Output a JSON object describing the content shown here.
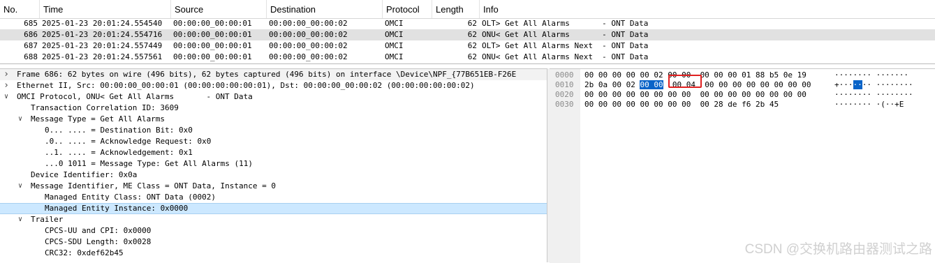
{
  "packet_list": {
    "columns": [
      "No.",
      "Time",
      "Source",
      "Destination",
      "Protocol",
      "Length",
      "Info"
    ],
    "rows": [
      {
        "no": "685",
        "time": "2025-01-23 20:01:24.554540",
        "src": "00:00:00_00:00:01",
        "dst": "00:00:00_00:00:02",
        "proto": "OMCI",
        "len": "62",
        "info": "OLT> Get All Alarms       - ONT Data"
      },
      {
        "no": "686",
        "time": "2025-01-23 20:01:24.554716",
        "src": "00:00:00_00:00:01",
        "dst": "00:00:00_00:00:02",
        "proto": "OMCI",
        "len": "62",
        "info": "ONU< Get All Alarms       - ONT Data"
      },
      {
        "no": "687",
        "time": "2025-01-23 20:01:24.557449",
        "src": "00:00:00_00:00:01",
        "dst": "00:00:00_00:00:02",
        "proto": "OMCI",
        "len": "62",
        "info": "OLT> Get All Alarms Next  - ONT Data"
      },
      {
        "no": "688",
        "time": "2025-01-23 20:01:24.557561",
        "src": "00:00:00_00:00:01",
        "dst": "00:00:00_00:00:02",
        "proto": "OMCI",
        "len": "62",
        "info": "ONU< Get All Alarms Next  - ONT Data"
      }
    ]
  },
  "details": {
    "lines": [
      {
        "arrow": "collapsed",
        "text": "Frame 686: 62 bytes on wire (496 bits), 62 bytes captured (496 bits) on interface \\Device\\NPF_{77B651EB-F26E"
      },
      {
        "arrow": "collapsed",
        "text": "Ethernet II, Src: 00:00:00_00:00:01 (00:00:00:00:00:01), Dst: 00:00:00_00:00:02 (00:00:00:00:00:02)"
      },
      {
        "arrow": "expanded",
        "text": "OMCI Protocol, ONU< Get All Alarms       - ONT Data"
      },
      {
        "arrow": "none",
        "text": "Transaction Correlation ID: 3609"
      },
      {
        "arrow": "expanded",
        "text": "Message Type = Get All Alarms"
      },
      {
        "arrow": "none",
        "text": "0... .... = Destination Bit: 0x0"
      },
      {
        "arrow": "none",
        "text": ".0.. .... = Acknowledge Request: 0x0"
      },
      {
        "arrow": "none",
        "text": "..1. .... = Acknowledgement: 0x1"
      },
      {
        "arrow": "none",
        "text": "...0 1011 = Message Type: Get All Alarms (11)"
      },
      {
        "arrow": "none",
        "text": "Device Identifier: 0x0a"
      },
      {
        "arrow": "expanded",
        "text": "Message Identifier, ME Class = ONT Data, Instance = 0"
      },
      {
        "arrow": "none",
        "text": "Managed Entity Class: ONT Data (0002)"
      },
      {
        "arrow": "none",
        "text": "Managed Entity Instance: 0x0000"
      },
      {
        "arrow": "expanded",
        "text": "Trailer"
      },
      {
        "arrow": "none",
        "text": "CPCS-UU and CPI: 0x0000"
      },
      {
        "arrow": "none",
        "text": "CPCS-SDU Length: 0x0028"
      },
      {
        "arrow": "none",
        "text": "CRC32: 0xdef62b45"
      }
    ]
  },
  "bytes": {
    "rows": [
      {
        "offset": "0000",
        "pre": "00 00 00 00 00 02 00 00  00 00 00 01 88 b5 0e 19",
        "hl": "",
        "post": "",
        "a_pre": "········ ·······",
        "a_hl": "",
        "a_post": ""
      },
      {
        "offset": "0010",
        "pre": "2b 0a 00 02 ",
        "hl": "00 00",
        "post": "  00 04  00 00 00 00 00 00 00 00",
        "a_pre": "+···",
        "a_hl": "··",
        "a_post": "·· ········"
      },
      {
        "offset": "0020",
        "pre": "00 00 00 00 00 00 00 00  00 00 00 00 00 00 00 00",
        "hl": "",
        "post": "",
        "a_pre": "········ ········",
        "a_hl": "",
        "a_post": ""
      },
      {
        "offset": "0030",
        "pre": "00 00 00 00 00 00 00 00  00 28 de f6 2b 45",
        "hl": "",
        "post": "",
        "a_pre": "········ ·(··+E",
        "a_hl": "",
        "a_post": ""
      }
    ]
  },
  "watermark": "CSDN @交换机路由器测试之路",
  "colors": {
    "selected_row": "#e1e1e1",
    "tree_selected": "#cce8ff",
    "byte_highlight": "#0a64c8",
    "annotation_box": "#e02020"
  }
}
